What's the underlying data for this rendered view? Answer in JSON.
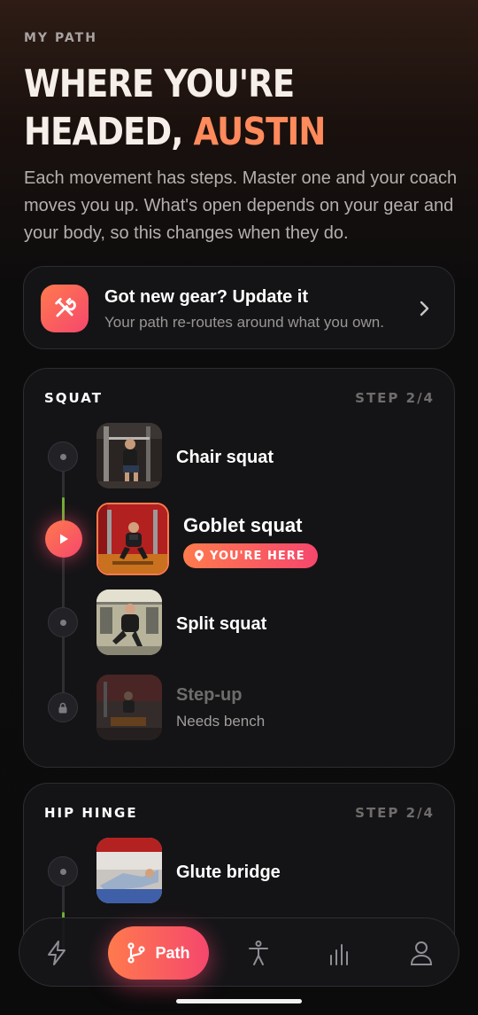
{
  "header": {
    "eyebrow": "MY PATH",
    "headline_line1": "WHERE YOU'RE",
    "headline_line2_prefix": "HEADED, ",
    "headline_name": "AUSTIN",
    "intro": "Each movement has steps. Master one and your coach moves you up. What's open depends on your gear and your body, so this changes when they do."
  },
  "gear_card": {
    "icon": "tools-icon",
    "title": "Got new gear? Update it",
    "subtitle": "Your path re-routes around what you own."
  },
  "groups": [
    {
      "title": "SQUAT",
      "step": "STEP 2/4",
      "items": [
        {
          "name": "Chair squat",
          "status": "done"
        },
        {
          "name": "Goblet squat",
          "status": "current",
          "badge": "YOU'RE HERE"
        },
        {
          "name": "Split squat",
          "status": "open"
        },
        {
          "name": "Step-up",
          "status": "locked",
          "note": "Needs bench"
        }
      ]
    },
    {
      "title": "HIP HINGE",
      "step": "STEP 2/4",
      "items": [
        {
          "name": "Glute bridge",
          "status": "done"
        }
      ]
    }
  ],
  "nav": {
    "items": [
      "bolt-icon",
      "path-icon",
      "body-icon",
      "stats-icon",
      "profile-icon"
    ],
    "active_label": "Path"
  },
  "colors": {
    "accent_start": "#ff7a4d",
    "accent_end": "#f5476d",
    "name_accent": "#ff8a5c"
  }
}
